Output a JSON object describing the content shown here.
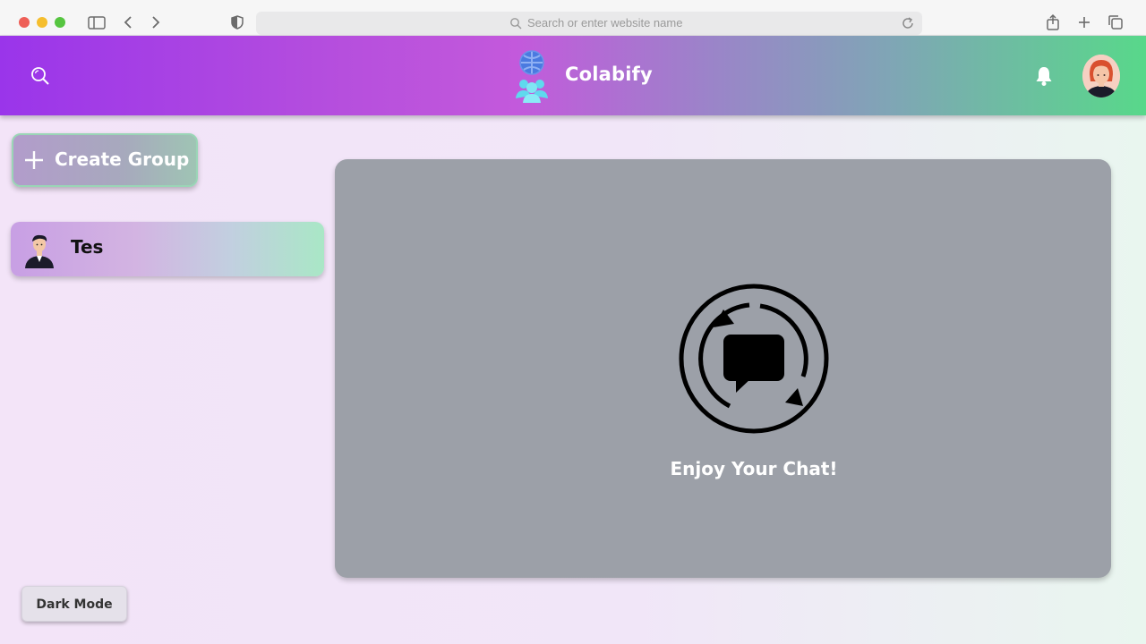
{
  "browser": {
    "address_placeholder": "Search or enter website name"
  },
  "header": {
    "brand": "Colabify"
  },
  "sidebar": {
    "create_group_label": "Create Group",
    "chats": [
      {
        "name": "Tes"
      }
    ]
  },
  "main": {
    "empty_message": "Enjoy Your Chat!"
  },
  "footer": {
    "dark_mode_label": "Dark Mode"
  },
  "colors": {
    "header_start": "#9a35ea",
    "header_end": "#58d88a",
    "panel": "#9ca0a8"
  }
}
